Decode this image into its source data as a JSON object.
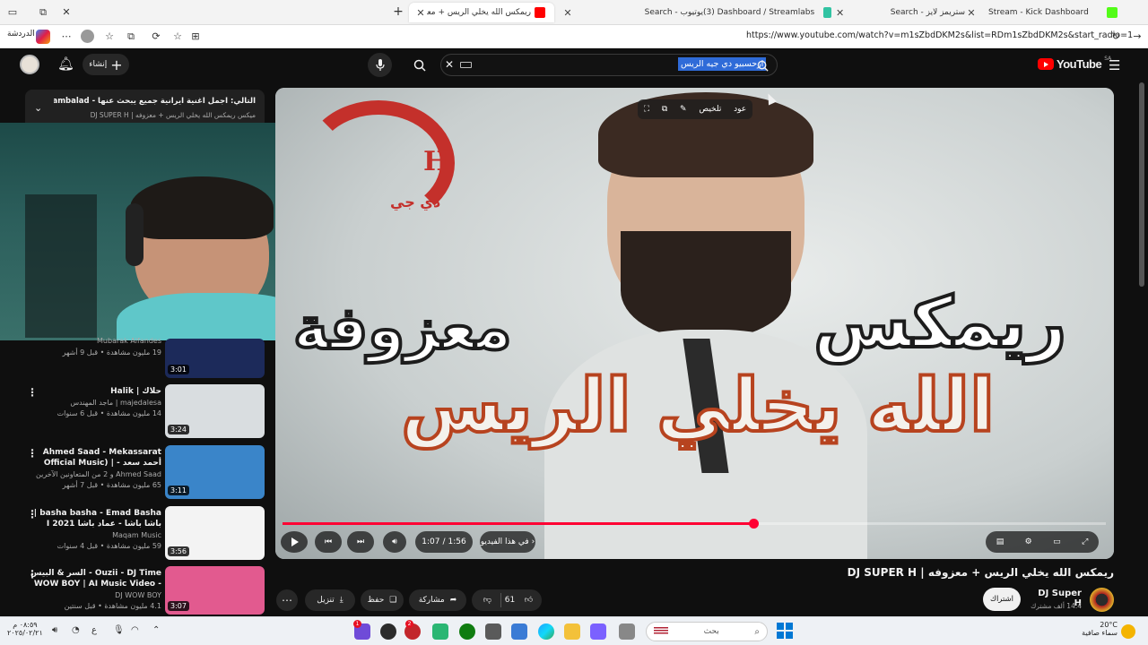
{
  "browser": {
    "profile_label": "الدردشة",
    "url": "https://www.youtube.com/watch?v=m1sZbdDKM2s&list=RDm1sZbdDKM2s&start_radio=1",
    "tabs": [
      {
        "label": "ريمكس الله يخلي الريس + معزوفه | ...",
        "active": true,
        "color": "#ff0000"
      },
      {
        "label": "Search - يوتيوب",
        "active": false,
        "color": "#ff0000"
      },
      {
        "label": "(3) Dashboard / Streamlabs",
        "active": false,
        "color": "#31c3a2"
      },
      {
        "label": "Search - ستريمز لايز",
        "active": false,
        "color": "#6e3ad1"
      },
      {
        "label": "Stream - Kick Dashboard",
        "active": false,
        "color": "#53fc18"
      }
    ]
  },
  "youtube": {
    "logo_text": "YouTube",
    "logo_country": "SA",
    "create_label": "إنشاء",
    "search_value": "ارحسبيو دي جيه الريس",
    "brand_red": "#ff0000"
  },
  "playlist": {
    "title": "التالي: اجمل اغنية ايرانية جميع يبحث عنها - Remix Kambalad...",
    "subtitle": "ميكس ريمكس الله يخلي الريس + معزوفه | DJ SUPER H"
  },
  "sidebar_videos": [
    {
      "title": "",
      "channel": "Mubarak Alfandes",
      "meta": "19 مليون مشاهدة • قبل 9 أشهر",
      "duration": "3:01",
      "thumb_color": "#1c2a5a"
    },
    {
      "title": "حلاك | Halik",
      "channel": "majedalesa | ماجد المهندس",
      "meta": "14 مليون مشاهدة • قبل 6 سنوات",
      "duration": "3:24",
      "thumb_color": "#d9dde0"
    },
    {
      "title": "Ahmed Saad - Mekassarat أحمد سعد - | (Official Music Video)...",
      "channel": "Ahmed Saad و 2 من المتعاونين الآخرين",
      "meta": "65 مليون مشاهدة • قبل 7 أشهر",
      "duration": "3:11",
      "thumb_color": "#3a85c9"
    },
    {
      "title": "basha basha - Emad Basha | باشا باشا - عماد باشا 2021 I exclusive",
      "channel": "Maqam Music",
      "meta": "59 مليون مشاهدة • قبل 4 سنوات",
      "duration": "3:56",
      "thumb_color": "#f3f3f3"
    },
    {
      "title": "Ouzii - DJ Time - السر & البيس - WOW BOY | AI Music Video",
      "channel": "DJ WOW BOY",
      "meta": "4.1 مليون مشاهدة • قبل سنتين",
      "duration": "3:07",
      "thumb_color": "#e25a8f"
    }
  ],
  "player": {
    "overlay_text_1": "ريمكس",
    "overlay_text_2": "معزوفة",
    "overlay_text_3": "الله يخلي الريس",
    "logo_mark": "H",
    "logo_sub": "دي جي",
    "top_chip": "تلخيص",
    "top_chip_2": "عود",
    "time_current": "1:07",
    "time_separator": "/",
    "time_total": "1:56",
    "chapter_chip": "في هذا الفيديو",
    "progress_fraction": 0.572,
    "progress_color": "#ff0033"
  },
  "video": {
    "title": "ريمكس الله يخلي الريس + معزوفه | DJ SUPER H",
    "channel": "DJ Super H",
    "subscribers": "14.4 ألف مشترك",
    "subscribe_label": "اشتراك",
    "likes": "61",
    "share_label": "مشاركة",
    "save_label": "حفظ",
    "download_label": "تنزيل"
  },
  "taskbar": {
    "weather_temp": "20°C",
    "weather_desc": "سماء صافية",
    "time": "٠٨:٥٩ م",
    "date": "٢٠٢٥/٠٢/٢١",
    "lang": "ع",
    "search_placeholder": "بحث",
    "badge_1": "1",
    "badge_2": "2"
  }
}
